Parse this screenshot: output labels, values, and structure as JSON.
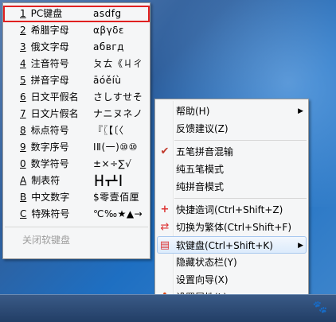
{
  "soft_keyboard_menu": {
    "items": [
      {
        "key": "1",
        "label": "PC键盘",
        "sample": "asdfg",
        "selected": true
      },
      {
        "key": "2",
        "label": "希腊字母",
        "sample": "αβγδε"
      },
      {
        "key": "3",
        "label": "俄文字母",
        "sample": "абвгд"
      },
      {
        "key": "4",
        "label": "注音符号",
        "sample": "ㄆㄊ《ㄐㄔ"
      },
      {
        "key": "5",
        "label": "拼音字母",
        "sample": "āóěíù"
      },
      {
        "key": "6",
        "label": "日文平假名",
        "sample": "さしすせそ"
      },
      {
        "key": "7",
        "label": "日文片假名",
        "sample": "ナニヌネノ"
      },
      {
        "key": "8",
        "label": "标点符号",
        "sample": "『〖【〔〈"
      },
      {
        "key": "9",
        "label": "数字序号",
        "sample": "ⅠⅡ(一)⑩⑩"
      },
      {
        "key": "0",
        "label": "数学符号",
        "sample": "±×÷∑√"
      },
      {
        "key": "A",
        "label": "制表符",
        "sample": "┣┫┳┻┃"
      },
      {
        "key": "B",
        "label": "中文数字",
        "sample": "$零壹佰厘"
      },
      {
        "key": "C",
        "label": "特殊符号",
        "sample": "℃‰★▲→"
      }
    ],
    "close_label": "关闭软键盘"
  },
  "context_menu": {
    "items": [
      {
        "label": "帮助(H)",
        "icon": "",
        "submenu": true
      },
      {
        "label": "反馈建议(Z)",
        "icon": ""
      },
      {
        "sep": true
      },
      {
        "label": "五笔拼音混输",
        "icon": "check-icon"
      },
      {
        "label": "纯五笔模式",
        "icon": ""
      },
      {
        "label": "纯拼音模式",
        "icon": ""
      },
      {
        "sep": true
      },
      {
        "label": "快捷造词(Ctrl+Shift+Z)",
        "icon": "plus-icon"
      },
      {
        "label": "切换为繁体(Ctrl+Shift+F)",
        "icon": "convert-icon"
      },
      {
        "label": "软键盘(Ctrl+Shift+K)",
        "icon": "keyboard-icon",
        "submenu": true,
        "highlighted": true
      },
      {
        "label": "隐藏状态栏(Y)",
        "icon": ""
      },
      {
        "label": "设置向导(X)",
        "icon": ""
      },
      {
        "label": "设置属性(L)",
        "icon": "gear-icon"
      }
    ]
  },
  "colors": {
    "selection_outline": "#e02020",
    "accent_red": "#d33333",
    "menu_background": "#f5f6f7"
  }
}
